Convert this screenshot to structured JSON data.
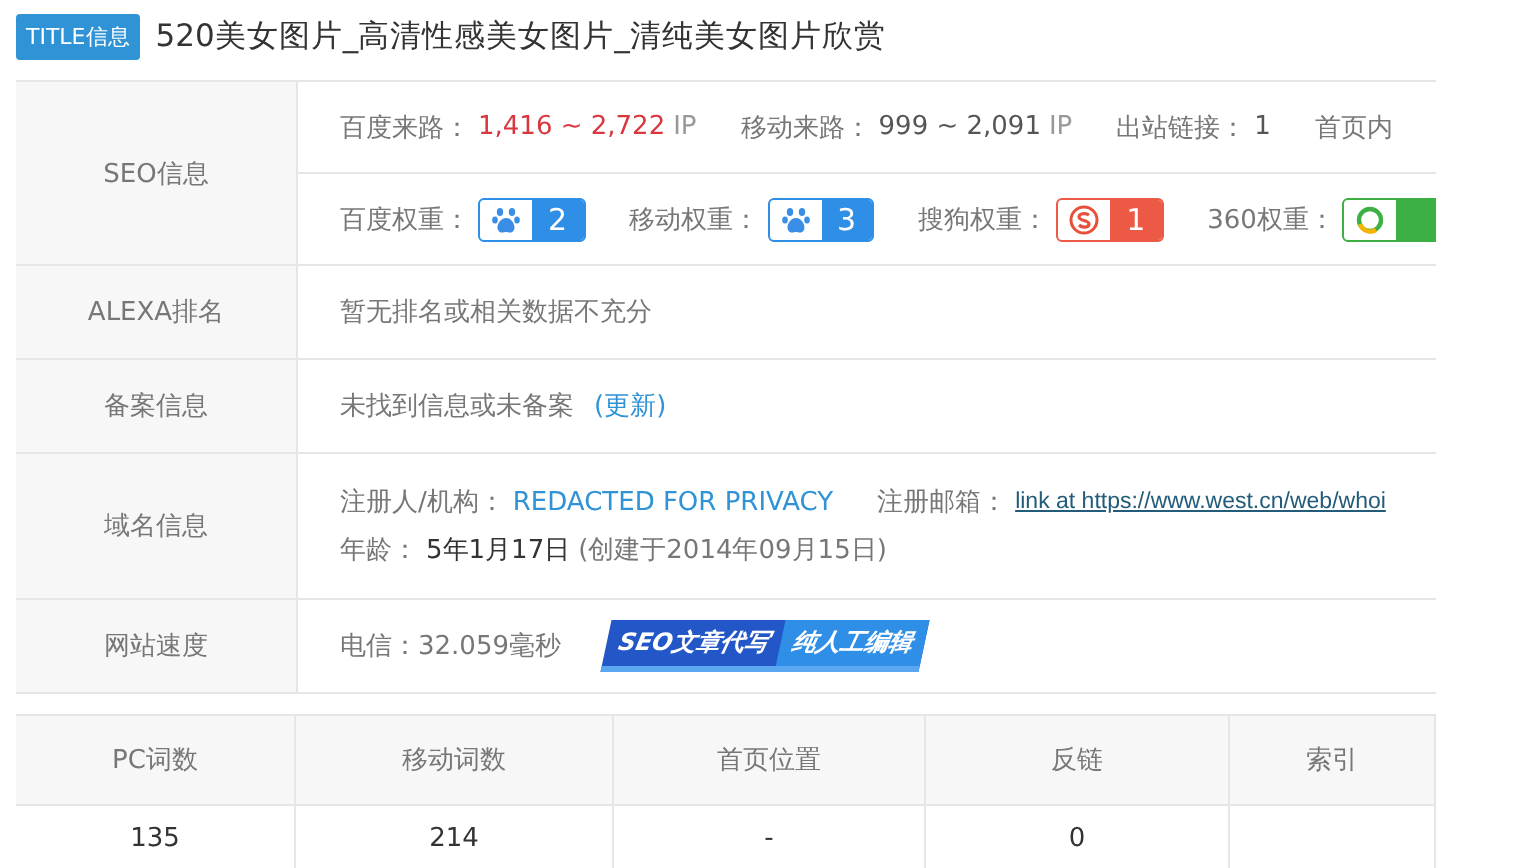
{
  "title": {
    "badge": "TITLE信息",
    "text": "520美女图片_高清性感美女图片_清纯美女图片欣赏"
  },
  "seo": {
    "label": "SEO信息",
    "traffic": [
      {
        "label": "百度来路：",
        "value": "1,416 ~ 2,722",
        "unit": "IP",
        "kind": "red"
      },
      {
        "label": "移动来路：",
        "value": "999 ~ 2,091",
        "unit": "IP",
        "kind": "plain"
      },
      {
        "label": "出站链接：",
        "value": "1",
        "kind": "plain"
      },
      {
        "label": "首页内"
      }
    ],
    "weights": [
      {
        "label": "百度权重：",
        "kind": "baidu",
        "value": "2"
      },
      {
        "label": "移动权重：",
        "kind": "mobile",
        "value": "3"
      },
      {
        "label": "搜狗权重：",
        "kind": "sogou",
        "value": "1"
      },
      {
        "label": "360权重：",
        "kind": "so360"
      }
    ]
  },
  "alexa": {
    "label": "ALEXA排名",
    "text": "暂无排名或相关数据不充分"
  },
  "icp": {
    "label": "备案信息",
    "text": "未找到信息或未备案",
    "link": "(更新)"
  },
  "domain": {
    "label": "域名信息",
    "registrant_label": "注册人/机构：",
    "registrant": "REDACTED FOR PRIVACY",
    "email_label": "注册邮箱：",
    "email": "link at https://www.west.cn/web/whoi",
    "age_label": "年龄：",
    "age": "5年1月17日",
    "created": "(创建于2014年09月15日)"
  },
  "speed": {
    "label": "网站速度",
    "text": "电信：32.059毫秒",
    "ad": [
      "SEO文章代写",
      "纯人工编辑"
    ]
  },
  "stats": {
    "columns": [
      "PC词数",
      "移动词数",
      "首页位置",
      "反链",
      "索引"
    ],
    "row": [
      "135",
      "214",
      "-",
      "0"
    ]
  }
}
